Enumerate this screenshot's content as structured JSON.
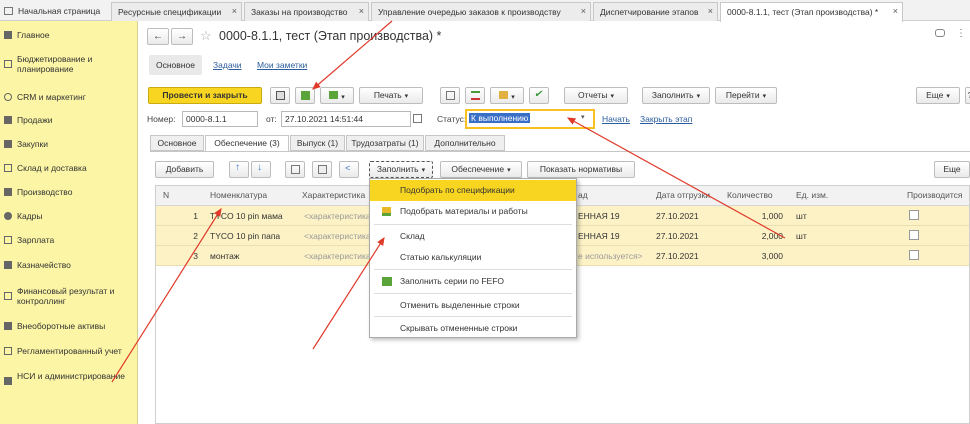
{
  "window_tabs": [
    {
      "label": "Начальная страница"
    },
    {
      "label": "Ресурсные спецификации"
    },
    {
      "label": "Заказы на производство"
    },
    {
      "label": "Управление очередью заказов к производству"
    },
    {
      "label": "Диспетчирование этапов"
    },
    {
      "label": "0000-8.1.1, тест (Этап производства) *"
    }
  ],
  "tab_close": "×",
  "sidebar": {
    "items": [
      {
        "label": "Главное"
      },
      {
        "label": "Бюджетирование и планирование"
      },
      {
        "label": "CRM и маркетинг"
      },
      {
        "label": "Продажи"
      },
      {
        "label": "Закупки"
      },
      {
        "label": "Склад и доставка"
      },
      {
        "label": "Производство"
      },
      {
        "label": "Кадры"
      },
      {
        "label": "Зарплата"
      },
      {
        "label": "Казначейство"
      },
      {
        "label": "Финансовый результат и контроллинг"
      },
      {
        "label": "Внеоборотные активы"
      },
      {
        "label": "Регламентированный учет"
      },
      {
        "label": "НСИ и администрирование"
      }
    ]
  },
  "form": {
    "nav_back": "←",
    "nav_fwd": "→",
    "star": "☆",
    "title": "0000-8.1.1, тест (Этап производства) *",
    "subnav": {
      "main": "Основное",
      "tasks": "Задачи",
      "notes": "Мои заметки"
    },
    "toolbar": {
      "post_close": "Провести и закрыть",
      "print": "Печать",
      "reports": "Отчеты",
      "fill": "Заполнить",
      "goto": "Перейти",
      "more": "Еще",
      "help": "?"
    },
    "header": {
      "number_label": "Номер:",
      "number": "0000-8.1.1",
      "date_label": "от:",
      "date": "27.10.2021 14:51:44",
      "status_label": "Статус:",
      "status": "К выполнению",
      "start_link": "Начать",
      "close_link": "Закрыть этап"
    },
    "tabs": [
      "Основное",
      "Обеспечение (3)",
      "Выпуск (1)",
      "Трудозатраты (1)",
      "Дополнительно"
    ],
    "tab_toolbar": {
      "add": "Добавить",
      "fill": "Заполнить",
      "provision": "Обеспечение",
      "show_norms": "Показать нормативы",
      "more": "Еще"
    }
  },
  "table": {
    "columns": [
      "N",
      "Номенклатура",
      "Характеристика",
      "",
      "Дата отгрузки",
      "Количество",
      "Ед. изм.",
      "Производится"
    ],
    "store_col_tail": "ад",
    "rows": [
      {
        "n": "1",
        "name": "TYCO 10 pin мама",
        "char": "<характеристика",
        "store": "ЕННАЯ 19",
        "date": "27.10.2021",
        "qty": "1,000",
        "unit": "шт"
      },
      {
        "n": "2",
        "name": "TYCO 10 pin папа",
        "char": "<характеристика",
        "store": "ЕННАЯ 19",
        "date": "27.10.2021",
        "qty": "2,000",
        "unit": "шт"
      },
      {
        "n": "3",
        "name": "монтаж",
        "char": "<характеристика",
        "store": "е используется>",
        "date": "27.10.2021",
        "qty": "3,000",
        "unit": ""
      }
    ]
  },
  "menu": {
    "items": [
      {
        "label": "Подобрать по спецификации",
        "icon": "none"
      },
      {
        "label": "Подобрать материалы и работы",
        "icon": "pick-icon"
      },
      {
        "label": "Склад",
        "icon": "none"
      },
      {
        "label": "Статью калькуляции",
        "icon": "none"
      },
      {
        "label": "Заполнить серии по FEFO",
        "icon": "fefo-icon"
      },
      {
        "label": "Отменить выделенные строки",
        "icon": "none"
      },
      {
        "label": "Скрывать отмененные строки",
        "icon": "none"
      }
    ]
  },
  "colors": {
    "accent": "#f8d520",
    "sidebar_bg": "#fbf5a5",
    "row_bg": "#fcf2c6",
    "link": "#2b5c9e",
    "annotation": "#e03a2a"
  }
}
